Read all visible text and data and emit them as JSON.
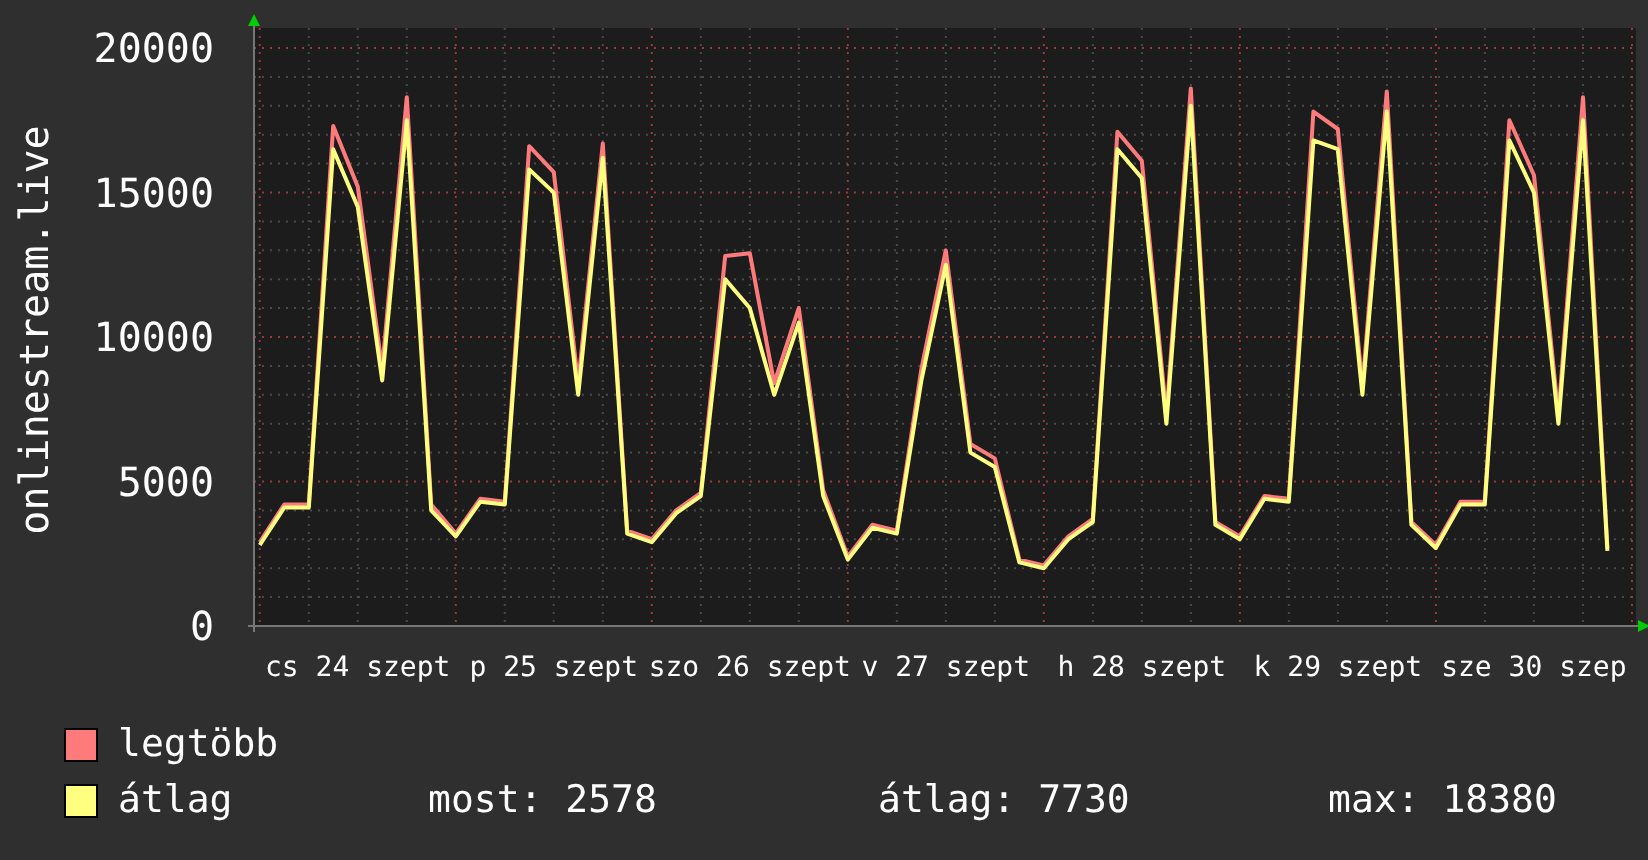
{
  "chart": {
    "chart_data": {
      "type": "line",
      "ylabel": "onlinestream.live",
      "grid": true,
      "ylim": [
        0,
        20000
      ],
      "yticks": [
        0,
        5000,
        10000,
        15000,
        20000
      ],
      "categories": [
        null,
        null,
        null,
        null,
        "cs 24 szept",
        null,
        null,
        null,
        null,
        null,
        null,
        null,
        "p 25 szept",
        null,
        null,
        null,
        null,
        null,
        null,
        null,
        "szo 26 szept",
        null,
        null,
        null,
        null,
        null,
        null,
        null,
        "v 27 szept",
        null,
        null,
        null,
        null,
        null,
        null,
        null,
        "h 28 szept",
        null,
        null,
        null,
        null,
        null,
        null,
        null,
        "k 29 szept",
        null,
        null,
        null,
        null,
        null,
        null,
        null,
        "sze 30 szep",
        null,
        null,
        null
      ],
      "series": [
        {
          "name": "legtöbb",
          "color": "#ff7b7b",
          "values": [
            2900,
            4200,
            4200,
            17300,
            15200,
            8900,
            18300,
            4200,
            3200,
            4400,
            4300,
            16600,
            15700,
            8400,
            16700,
            3300,
            3000,
            4000,
            4600,
            12800,
            12900,
            8400,
            11000,
            4700,
            2400,
            3500,
            3300,
            8900,
            13000,
            6300,
            5800,
            2300,
            2100,
            3100,
            3700,
            17100,
            16100,
            7300,
            18600,
            3600,
            3100,
            4500,
            4400,
            17800,
            17200,
            8300,
            18500,
            3600,
            2800,
            4300,
            4300,
            17500,
            15600,
            7300,
            18300,
            2700
          ]
        },
        {
          "name": "átlag",
          "color": "#ffff80",
          "values": [
            2800,
            4100,
            4100,
            16500,
            14500,
            8500,
            17500,
            4000,
            3100,
            4300,
            4200,
            15800,
            15000,
            8000,
            16200,
            3200,
            2900,
            3900,
            4500,
            12000,
            11000,
            8000,
            10500,
            4500,
            2300,
            3400,
            3200,
            8500,
            12500,
            6000,
            5500,
            2200,
            2000,
            3000,
            3600,
            16500,
            15500,
            7000,
            18000,
            3500,
            3000,
            4400,
            4300,
            16800,
            16500,
            8000,
            17800,
            3500,
            2700,
            4200,
            4200,
            16800,
            15000,
            7000,
            17500,
            2600
          ]
        }
      ]
    }
  },
  "stats": [
    "most: 2578",
    "átlag: 7730",
    "max: 18380"
  ]
}
